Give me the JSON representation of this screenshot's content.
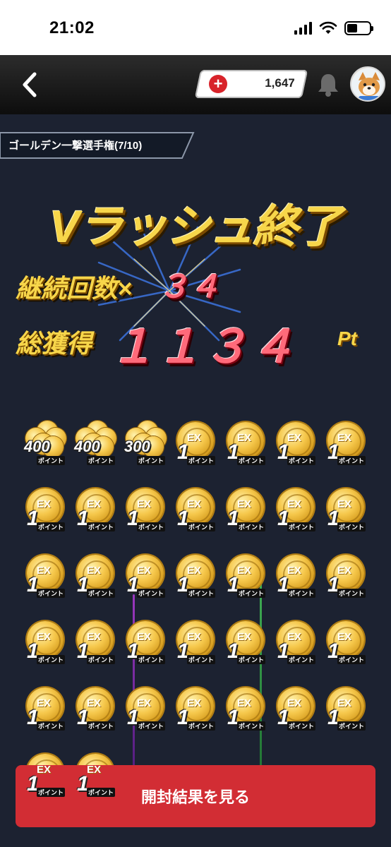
{
  "status_bar": {
    "time": "21:02",
    "battery_level": 0.45
  },
  "header": {
    "back_icon": "chevron-left-icon",
    "points": "1,647",
    "add_icon": "plus-icon",
    "bell_icon": "bell-icon",
    "avatar_icon": "shiba-avatar"
  },
  "event": {
    "title": "ゴールデン一撃選手権(7/10)"
  },
  "result": {
    "title": "Vラッシュ終了",
    "streak_label": "継続回数×",
    "streak_value": "３４",
    "total_label": "総獲得",
    "total_value": "１１３４",
    "unit": "Pt"
  },
  "prizes": {
    "sub_label": "ポイント",
    "ex_label": "EX",
    "items": [
      {
        "kind": "pile",
        "value": "400"
      },
      {
        "kind": "pile",
        "value": "400"
      },
      {
        "kind": "pile",
        "value": "300"
      },
      {
        "kind": "ex",
        "value": "1"
      },
      {
        "kind": "ex",
        "value": "1"
      },
      {
        "kind": "ex",
        "value": "1"
      },
      {
        "kind": "ex",
        "value": "1"
      },
      {
        "kind": "ex",
        "value": "1"
      },
      {
        "kind": "ex",
        "value": "1"
      },
      {
        "kind": "ex",
        "value": "1"
      },
      {
        "kind": "ex",
        "value": "1"
      },
      {
        "kind": "ex",
        "value": "1"
      },
      {
        "kind": "ex",
        "value": "1"
      },
      {
        "kind": "ex",
        "value": "1"
      },
      {
        "kind": "ex",
        "value": "1"
      },
      {
        "kind": "ex",
        "value": "1"
      },
      {
        "kind": "ex",
        "value": "1"
      },
      {
        "kind": "ex",
        "value": "1"
      },
      {
        "kind": "ex",
        "value": "1"
      },
      {
        "kind": "ex",
        "value": "1"
      },
      {
        "kind": "ex",
        "value": "1"
      },
      {
        "kind": "ex",
        "value": "1"
      },
      {
        "kind": "ex",
        "value": "1"
      },
      {
        "kind": "ex",
        "value": "1"
      },
      {
        "kind": "ex",
        "value": "1"
      },
      {
        "kind": "ex",
        "value": "1"
      },
      {
        "kind": "ex",
        "value": "1"
      },
      {
        "kind": "ex",
        "value": "1"
      },
      {
        "kind": "ex",
        "value": "1"
      },
      {
        "kind": "ex",
        "value": "1"
      },
      {
        "kind": "ex",
        "value": "1"
      },
      {
        "kind": "ex",
        "value": "1"
      },
      {
        "kind": "ex",
        "value": "1"
      },
      {
        "kind": "ex",
        "value": "1"
      },
      {
        "kind": "ex",
        "value": "1"
      },
      {
        "kind": "ex",
        "value": "1"
      },
      {
        "kind": "ex",
        "value": "1"
      }
    ]
  },
  "actions": {
    "open_result": "開封結果を見る"
  },
  "colors": {
    "accent": "#d22d34",
    "gold": "#f7d64a",
    "background": "#1c2231"
  }
}
